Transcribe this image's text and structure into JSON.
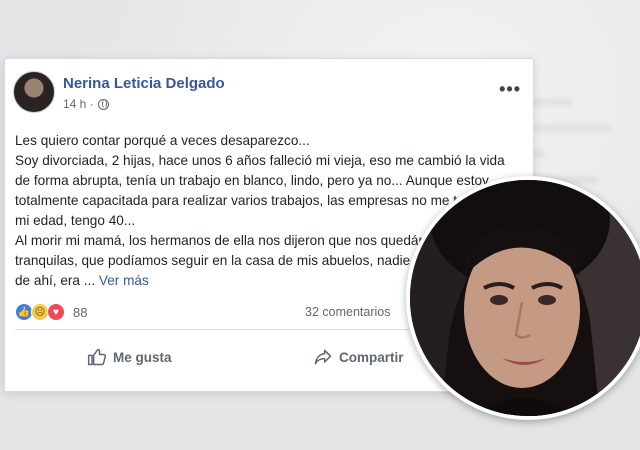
{
  "post": {
    "author": "Nerina Leticia Delgado",
    "time": "14 h ·",
    "more": "•••",
    "paragraphs": [
      "Les quiero contar porqué a veces desaparezco...",
      "Soy divorciada, 2 hijas, hace unos 6 años falleció mi vieja, eso me cambió la vida de forma abrupta, tenía un trabajo en blanco, lindo, pero ya no... Aunque estoy totalmente capacitada para realizar varios trabajos, las empresas no me toman por mi edad, tengo 40...",
      "Al morir mi mamá, los hermanos de ella nos dijeron que nos quedáramos tranquilas, que podíamos seguir en la casa de mis abuelos, nadie nos iba a sacar de ahí, era ..."
    ],
    "see_more": "Ver más",
    "reaction_count": "88",
    "comments": "32 comentarios",
    "like_label": "Me gusta",
    "share_label": "Compartir"
  },
  "colors": {
    "link_blue": "#385898",
    "text": "#1d2129",
    "secondary": "#616770"
  }
}
